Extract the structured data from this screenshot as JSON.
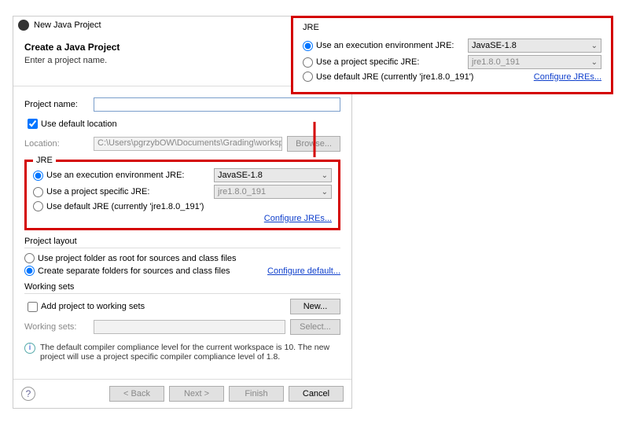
{
  "titlebar": {
    "title": "New Java Project"
  },
  "banner": {
    "heading": "Create a Java Project",
    "subheading": "Enter a project name."
  },
  "projectName": {
    "label": "Project name:",
    "value": ""
  },
  "defaultLocation": {
    "label": "Use default location",
    "checked": true
  },
  "location": {
    "label": "Location:",
    "path": "C:\\Users\\pgrzybOW\\Documents\\Grading\\workspace",
    "browse": "Browse..."
  },
  "jre": {
    "title": "JRE",
    "opt1": {
      "label": "Use an execution environment JRE:",
      "value": "JavaSE-1.8"
    },
    "opt2": {
      "label": "Use a project specific JRE:",
      "value": "jre1.8.0_191"
    },
    "opt3": {
      "label": "Use default JRE (currently 'jre1.8.0_191')"
    },
    "configure": "Configure JREs..."
  },
  "layout": {
    "title": "Project layout",
    "opt1": "Use project folder as root for sources and class files",
    "opt2": "Create separate folders for sources and class files",
    "configure": "Configure default..."
  },
  "workingSets": {
    "title": "Working sets",
    "addLabel": "Add project to working sets",
    "listLabel": "Working sets:",
    "newBtn": "New...",
    "selectBtn": "Select..."
  },
  "info": {
    "text": "The default compiler compliance level for the current workspace is 10. The new project will use a project specific compiler compliance level of 1.8."
  },
  "buttons": {
    "back": "< Back",
    "next": "Next >",
    "finish": "Finish",
    "cancel": "Cancel"
  }
}
